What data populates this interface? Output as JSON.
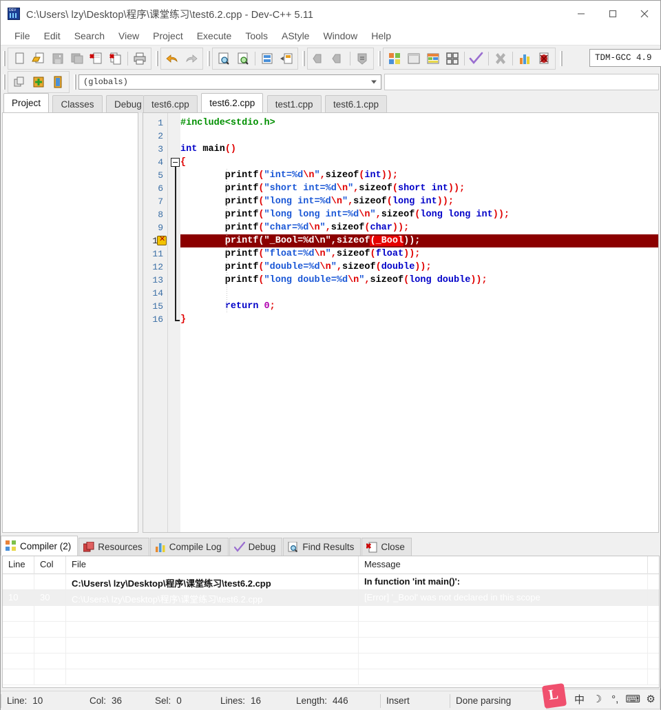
{
  "window": {
    "title": "C:\\Users\\ lzy\\Desktop\\程序\\课堂练习\\test6.2.cpp - Dev-C++ 5.11",
    "minimize_label": "Minimize",
    "maximize_label": "Maximize",
    "close_label": "Close"
  },
  "menubar": {
    "items": [
      {
        "label": "File"
      },
      {
        "label": "Edit"
      },
      {
        "label": "Search"
      },
      {
        "label": "View"
      },
      {
        "label": "Project"
      },
      {
        "label": "Execute"
      },
      {
        "label": "Tools"
      },
      {
        "label": "AStyle"
      },
      {
        "label": "Window"
      },
      {
        "label": "Help"
      }
    ]
  },
  "toolbar": {
    "compiler_selector_value": "TDM-GCC 4.9",
    "scope_combo_value": "(globals)",
    "buttons": [
      {
        "name": "new-file-icon",
        "tip": "New file"
      },
      {
        "name": "open-file-icon",
        "tip": "Open"
      },
      {
        "name": "save-icon",
        "tip": "Save"
      },
      {
        "name": "save-all-icon",
        "tip": "Save All"
      },
      {
        "name": "close-file-icon",
        "tip": "Close"
      },
      {
        "name": "close-all-icon",
        "tip": "Close All"
      },
      {
        "name": "print-icon",
        "tip": "Print"
      },
      {
        "name": "undo-icon",
        "tip": "Undo"
      },
      {
        "name": "redo-icon",
        "tip": "Redo"
      },
      {
        "name": "find-icon",
        "tip": "Find"
      },
      {
        "name": "find-next-icon",
        "tip": "Find Next"
      },
      {
        "name": "replace-icon",
        "tip": "Replace"
      },
      {
        "name": "goto-line-icon",
        "tip": "Goto line"
      },
      {
        "name": "back-icon",
        "tip": "Back"
      },
      {
        "name": "forward-icon",
        "tip": "Forward"
      },
      {
        "name": "insert-icon",
        "tip": "Insert"
      },
      {
        "name": "compile-icon",
        "tip": "Compile"
      },
      {
        "name": "run-icon",
        "tip": "Run"
      },
      {
        "name": "compile-run-icon",
        "tip": "Compile & Run"
      },
      {
        "name": "rebuild-all-icon",
        "tip": "Rebuild All"
      },
      {
        "name": "syntax-check-icon",
        "tip": "Syntax Check"
      },
      {
        "name": "stop-icon",
        "tip": "Stop Execution"
      },
      {
        "name": "profile-icon",
        "tip": "Profile"
      },
      {
        "name": "debug-icon",
        "tip": "Debug"
      }
    ],
    "row2_buttons": [
      {
        "name": "project-new-icon",
        "tip": "New project"
      },
      {
        "name": "add-to-project-icon",
        "tip": "Add to project"
      },
      {
        "name": "project-options-icon",
        "tip": "Project options"
      }
    ]
  },
  "panel_tabs": [
    {
      "label": "Project",
      "active": true
    },
    {
      "label": "Classes",
      "active": false
    },
    {
      "label": "Debug",
      "active": false
    }
  ],
  "file_tabs": [
    {
      "label": "test6.cpp",
      "active": false
    },
    {
      "label": "test6.2.cpp",
      "active": true
    },
    {
      "label": "test1.cpp",
      "active": false
    },
    {
      "label": "test6.1.cpp",
      "active": false
    }
  ],
  "editor": {
    "error_line": 10,
    "total_lines": 16,
    "lines": [
      {
        "n": 1,
        "tokens": [
          {
            "t": "#include<stdio.h>",
            "c": "pre"
          }
        ]
      },
      {
        "n": 2,
        "tokens": []
      },
      {
        "n": 3,
        "tokens": [
          {
            "t": "int",
            "c": "kw"
          },
          {
            "t": " main",
            "c": "id"
          },
          {
            "t": "()",
            "c": "punc"
          }
        ]
      },
      {
        "n": 4,
        "tokens": [
          {
            "t": "{",
            "c": "punc"
          }
        ]
      },
      {
        "n": 5,
        "tokens": [
          {
            "t": "        printf",
            "c": "id"
          },
          {
            "t": "(",
            "c": "punc"
          },
          {
            "t": "\"int=%d",
            "c": "str"
          },
          {
            "t": "\\n",
            "c": "esc"
          },
          {
            "t": "\"",
            "c": "str"
          },
          {
            "t": ",",
            "c": "punc"
          },
          {
            "t": "sizeof",
            "c": "id"
          },
          {
            "t": "(",
            "c": "punc"
          },
          {
            "t": "int",
            "c": "kw"
          },
          {
            "t": "));",
            "c": "punc"
          }
        ]
      },
      {
        "n": 6,
        "tokens": [
          {
            "t": "        printf",
            "c": "id"
          },
          {
            "t": "(",
            "c": "punc"
          },
          {
            "t": "\"short int=%d",
            "c": "str"
          },
          {
            "t": "\\n",
            "c": "esc"
          },
          {
            "t": "\"",
            "c": "str"
          },
          {
            "t": ",",
            "c": "punc"
          },
          {
            "t": "sizeof",
            "c": "id"
          },
          {
            "t": "(",
            "c": "punc"
          },
          {
            "t": "short int",
            "c": "kw"
          },
          {
            "t": "));",
            "c": "punc"
          }
        ]
      },
      {
        "n": 7,
        "tokens": [
          {
            "t": "        printf",
            "c": "id"
          },
          {
            "t": "(",
            "c": "punc"
          },
          {
            "t": "\"long int=%d",
            "c": "str"
          },
          {
            "t": "\\n",
            "c": "esc"
          },
          {
            "t": "\"",
            "c": "str"
          },
          {
            "t": ",",
            "c": "punc"
          },
          {
            "t": "sizeof",
            "c": "id"
          },
          {
            "t": "(",
            "c": "punc"
          },
          {
            "t": "long int",
            "c": "kw"
          },
          {
            "t": "));",
            "c": "punc"
          }
        ]
      },
      {
        "n": 8,
        "tokens": [
          {
            "t": "        printf",
            "c": "id"
          },
          {
            "t": "(",
            "c": "punc"
          },
          {
            "t": "\"long long int=%d",
            "c": "str"
          },
          {
            "t": "\\n",
            "c": "esc"
          },
          {
            "t": "\"",
            "c": "str"
          },
          {
            "t": ",",
            "c": "punc"
          },
          {
            "t": "sizeof",
            "c": "id"
          },
          {
            "t": "(",
            "c": "punc"
          },
          {
            "t": "long long int",
            "c": "kw"
          },
          {
            "t": "));",
            "c": "punc"
          }
        ]
      },
      {
        "n": 9,
        "tokens": [
          {
            "t": "        printf",
            "c": "id"
          },
          {
            "t": "(",
            "c": "punc"
          },
          {
            "t": "\"char=%d",
            "c": "str"
          },
          {
            "t": "\\n",
            "c": "esc"
          },
          {
            "t": "\"",
            "c": "str"
          },
          {
            "t": ",",
            "c": "punc"
          },
          {
            "t": "sizeof",
            "c": "id"
          },
          {
            "t": "(",
            "c": "punc"
          },
          {
            "t": "char",
            "c": "kw"
          },
          {
            "t": "));",
            "c": "punc"
          }
        ]
      },
      {
        "n": 10,
        "highlight": true,
        "tokens": [
          {
            "t": "        printf",
            "c": "id"
          },
          {
            "t": "(",
            "c": "punc"
          },
          {
            "t": "\"_Bool=%d",
            "c": "str"
          },
          {
            "t": "\\n",
            "c": "esc"
          },
          {
            "t": "\"",
            "c": "str"
          },
          {
            "t": ",",
            "c": "punc"
          },
          {
            "t": "sizeof",
            "c": "id"
          },
          {
            "t": "(_Bool",
            "c": "punc",
            "sel": true
          },
          {
            "t": "));",
            "c": "punc"
          }
        ]
      },
      {
        "n": 11,
        "tokens": [
          {
            "t": "        printf",
            "c": "id"
          },
          {
            "t": "(",
            "c": "punc"
          },
          {
            "t": "\"float=%d",
            "c": "str"
          },
          {
            "t": "\\n",
            "c": "esc"
          },
          {
            "t": "\"",
            "c": "str"
          },
          {
            "t": ",",
            "c": "punc"
          },
          {
            "t": "sizeof",
            "c": "id"
          },
          {
            "t": "(",
            "c": "punc"
          },
          {
            "t": "float",
            "c": "kw"
          },
          {
            "t": "));",
            "c": "punc"
          }
        ]
      },
      {
        "n": 12,
        "tokens": [
          {
            "t": "        printf",
            "c": "id"
          },
          {
            "t": "(",
            "c": "punc"
          },
          {
            "t": "\"double=%d",
            "c": "str"
          },
          {
            "t": "\\n",
            "c": "esc"
          },
          {
            "t": "\"",
            "c": "str"
          },
          {
            "t": ",",
            "c": "punc"
          },
          {
            "t": "sizeof",
            "c": "id"
          },
          {
            "t": "(",
            "c": "punc"
          },
          {
            "t": "double",
            "c": "kw"
          },
          {
            "t": "));",
            "c": "punc"
          }
        ]
      },
      {
        "n": 13,
        "tokens": [
          {
            "t": "        printf",
            "c": "id"
          },
          {
            "t": "(",
            "c": "punc"
          },
          {
            "t": "\"long double=%d",
            "c": "str"
          },
          {
            "t": "\\n",
            "c": "esc"
          },
          {
            "t": "\"",
            "c": "str"
          },
          {
            "t": ",",
            "c": "punc"
          },
          {
            "t": "sizeof",
            "c": "id"
          },
          {
            "t": "(",
            "c": "punc"
          },
          {
            "t": "long double",
            "c": "kw"
          },
          {
            "t": "));",
            "c": "punc"
          }
        ]
      },
      {
        "n": 14,
        "tokens": []
      },
      {
        "n": 15,
        "tokens": [
          {
            "t": "        ",
            "c": "id"
          },
          {
            "t": "return",
            "c": "kw"
          },
          {
            "t": " ",
            "c": "id"
          },
          {
            "t": "0",
            "c": "num"
          },
          {
            "t": ";",
            "c": "punc"
          }
        ]
      },
      {
        "n": 16,
        "tokens": [
          {
            "t": "}",
            "c": "punc"
          }
        ]
      }
    ]
  },
  "bottom_tabs": [
    {
      "label": "Compiler (2)",
      "icon": "grid-icon",
      "active": true
    },
    {
      "label": "Resources",
      "icon": "layers-icon",
      "active": false
    },
    {
      "label": "Compile Log",
      "icon": "bars-icon",
      "active": false
    },
    {
      "label": "Debug",
      "icon": "check-icon",
      "active": false
    },
    {
      "label": "Find Results",
      "icon": "magnifier-icon",
      "active": false
    },
    {
      "label": "Close",
      "icon": "close-x-icon",
      "active": false
    }
  ],
  "messages": {
    "headers": [
      "Line",
      "Col",
      "File",
      "Message"
    ],
    "rows": [
      {
        "line": "",
        "col": "",
        "file": "C:\\Users\\ lzy\\Desktop\\程序\\课堂练习\\test6.2.cpp",
        "message": "In function 'int main()':",
        "bold": true,
        "selected": false
      },
      {
        "line": "10",
        "col": "30",
        "file": "C:\\Users\\ lzy\\Desktop\\程序\\课堂练习\\test6.2.cpp",
        "message": "[Error] '_Bool' was not declared in this scope",
        "bold": false,
        "selected": true
      }
    ],
    "empty_row_count": 5
  },
  "statusbar": {
    "cells": [
      {
        "label": "Line:",
        "value": "10"
      },
      {
        "label": "Col:",
        "value": "36"
      },
      {
        "label": "Sel:",
        "value": "0"
      },
      {
        "label": "Lines:",
        "value": "16"
      },
      {
        "label": "Length:",
        "value": "446"
      }
    ],
    "mode": "Insert",
    "parse_status": "Done parsing"
  },
  "ime": {
    "logo": "L",
    "items": [
      {
        "name": "chinese-mode-icon",
        "glyph": "中"
      },
      {
        "name": "moon-icon",
        "glyph": "☽"
      },
      {
        "name": "punctuation-icon",
        "glyph": "°,"
      },
      {
        "name": "keyboard-icon",
        "glyph": "⌨"
      },
      {
        "name": "settings-gear-icon",
        "glyph": "⚙"
      }
    ]
  },
  "colors": {
    "error_line_bg": "#8b0000",
    "selection_bg": "#e60000",
    "keyword": "#0000c8",
    "string": "#1a57d6",
    "escape": "#e00000",
    "preprocessor": "#009000",
    "number": "#b000b0",
    "line_number": "#3a6ea5"
  }
}
